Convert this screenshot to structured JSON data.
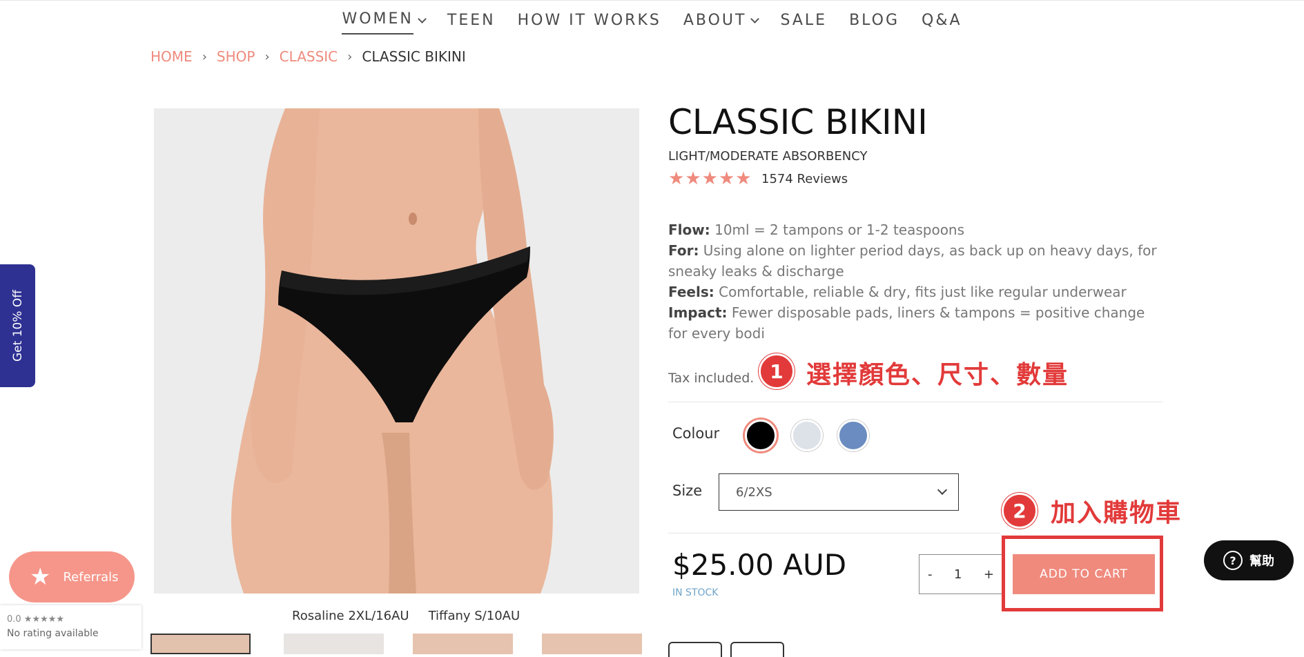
{
  "nav": {
    "items": [
      {
        "label": "WOMEN",
        "dropdown": true,
        "active": true
      },
      {
        "label": "TEEN",
        "dropdown": false
      },
      {
        "label": "HOW IT WORKS",
        "dropdown": false
      },
      {
        "label": "ABOUT",
        "dropdown": true
      },
      {
        "label": "SALE",
        "dropdown": false
      },
      {
        "label": "BLOG",
        "dropdown": false
      },
      {
        "label": "Q&A",
        "dropdown": false
      }
    ]
  },
  "breadcrumb": {
    "home": "HOME",
    "shop": "SHOP",
    "classic": "CLASSIC",
    "current": "CLASSIC BIKINI",
    "separator": "›"
  },
  "gallery": {
    "caption_left": "Rosaline 2XL/16AU",
    "caption_right": "Tiffany S/10AU"
  },
  "product": {
    "title": "CLASSIC BIKINI",
    "subtitle": "LIGHT/MODERATE ABSORBENCY",
    "rating_stars": 5,
    "reviews": "1574 Reviews",
    "flow_label": "Flow:",
    "flow_text": " 10ml = 2 tampons or 1-2 teaspoons",
    "for_label": "For:",
    "for_text": " Using alone on lighter period days, as back up on heavy days, for sneaky leaks & discharge",
    "feels_label": "Feels:",
    "feels_text": " Comfortable, reliable & dry, fits just like regular underwear",
    "impact_label": "Impact:",
    "impact_text": " Fewer disposable pads, liners & tampons = positive change for every bodi",
    "tax": "Tax included.",
    "colour_label": "Colour",
    "colours": [
      "#000000",
      "#dde1e8",
      "#6a8cc0"
    ],
    "selected_colour": "#000000",
    "size_label": "Size",
    "size_value": "6/2XS",
    "price": "$25.00 AUD",
    "stock": "IN STOCK",
    "qty_minus": "-",
    "qty_value": "1",
    "qty_plus": "+",
    "add_to_cart": "ADD TO CART"
  },
  "annotations": {
    "step1_num": "1",
    "step1_text": "選擇顏色、尺寸、數量",
    "step2_num": "2",
    "step2_text": "加入購物車",
    "color": "#e23a3a"
  },
  "widgets": {
    "sidetab": "Get 10% Off",
    "referrals": "Referrals",
    "rating_score": "0.0 ★★★★★",
    "rating_text": "No rating available",
    "help_icon": "?",
    "help_text": "幫助"
  },
  "colors": {
    "accent": "#ef8a7d",
    "sidetab": "#2e3192",
    "stock": "#6fa4c9"
  }
}
